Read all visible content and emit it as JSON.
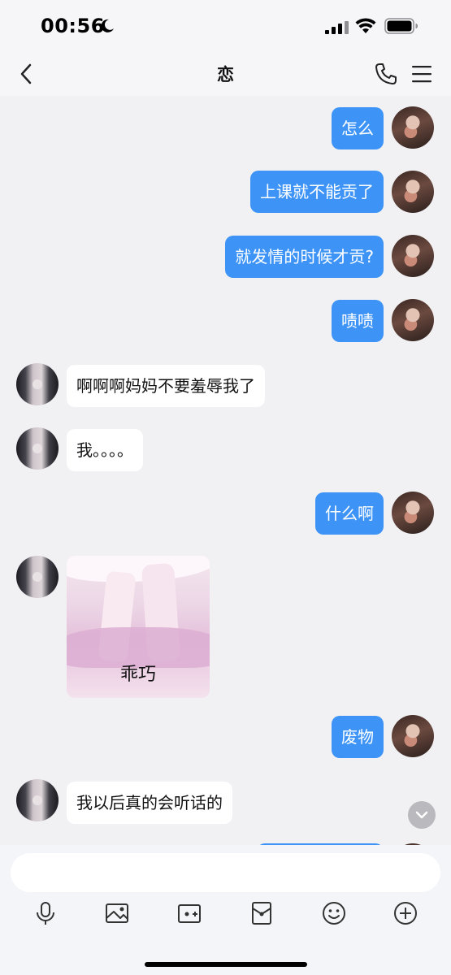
{
  "status_bar": {
    "time": "00:56"
  },
  "nav": {
    "title": "恋"
  },
  "messages": [
    {
      "from": "me",
      "text": "怎么"
    },
    {
      "from": "me",
      "text": "上课就不能贡了"
    },
    {
      "from": "me",
      "text": "就发情的时候才贡?"
    },
    {
      "from": "me",
      "text": "啧啧"
    },
    {
      "from": "them",
      "text": "啊啊啊妈妈不要羞辱我了"
    },
    {
      "from": "them",
      "text": "我。。。。"
    },
    {
      "from": "me",
      "text": "什么啊"
    },
    {
      "from": "them",
      "type": "sticker",
      "text": "乖巧"
    },
    {
      "from": "me",
      "text": "废物"
    },
    {
      "from": "them",
      "text": "我以后真的会听话的"
    }
  ],
  "input": {
    "placeholder": ""
  },
  "toolbar": [
    "mic-icon",
    "image-icon",
    "camera-icon",
    "red-packet-icon",
    "emoji-icon",
    "plus-icon"
  ],
  "colors": {
    "bubble_me": "#3d94f6",
    "bubble_them": "#ffffff",
    "background": "#f1f1f3"
  }
}
